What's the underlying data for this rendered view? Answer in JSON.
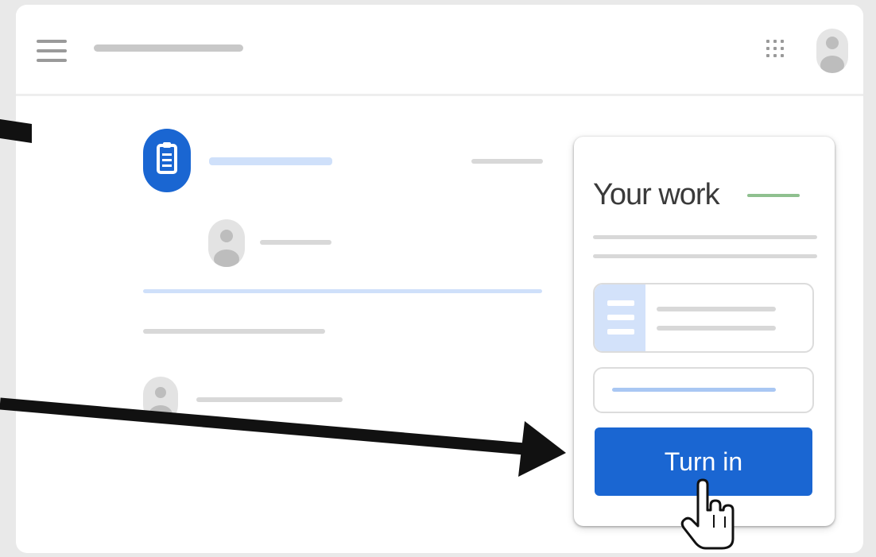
{
  "card": {
    "title": "Your work",
    "turn_in_label": "Turn in"
  },
  "icons": {
    "menu": "hamburger-menu-icon",
    "apps": "apps-grid-icon",
    "avatar": "user-avatar-icon",
    "assignment": "assignment-clipboard-icon",
    "document": "document-icon",
    "cursor": "hand-pointer-cursor-icon"
  },
  "colors": {
    "accent": "#1a66d2",
    "accent_light": "#cfe0fa",
    "status_green": "#8fc08f",
    "placeholder_gray": "#d8d8d8",
    "annotation_arrow": "#000000"
  }
}
